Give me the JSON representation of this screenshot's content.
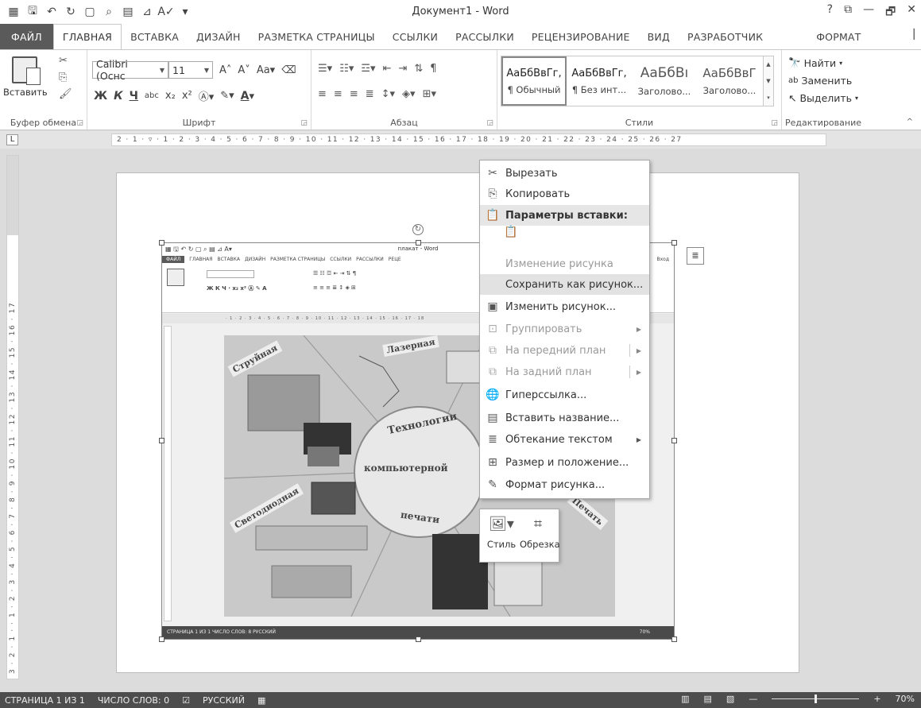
{
  "window": {
    "title": "Документ1 - Word",
    "controls": [
      "?",
      "⧉",
      "—",
      "🗗",
      "✕"
    ]
  },
  "tabs": [
    {
      "label": "ФАЙЛ"
    },
    {
      "label": "ГЛАВНАЯ"
    },
    {
      "label": "ВСТАВКА"
    },
    {
      "label": "ДИЗАЙН"
    },
    {
      "label": "РАЗМЕТКА СТРАНИЦЫ"
    },
    {
      "label": "ССЫЛКИ"
    },
    {
      "label": "РАССЫЛКИ"
    },
    {
      "label": "РЕЦЕНЗИРОВАНИЕ"
    },
    {
      "label": "ВИД"
    },
    {
      "label": "РАЗРАБОТЧИК"
    },
    {
      "label": "ФОРМАТ"
    }
  ],
  "ribbon": {
    "clipboard": {
      "paste_label": "Вставить",
      "group_label": "Буфер обмена"
    },
    "font": {
      "name": "Calibri (Оснс",
      "size": "11",
      "group_label": "Шрифт"
    },
    "paragraph": {
      "group_label": "Абзац"
    },
    "styles": {
      "group_label": "Стили",
      "items": [
        {
          "sample": "АаБбВвГг,",
          "name": "¶ Обычный"
        },
        {
          "sample": "АаБбВвГг,",
          "name": "¶ Без инт..."
        },
        {
          "sample": "АаБбВı",
          "name": "Заголово..."
        },
        {
          "sample": "АаБбВвГ",
          "name": "Заголово..."
        }
      ]
    },
    "editing": {
      "group_label": "Редактирование",
      "find": "Найти",
      "replace": "Заменить",
      "select": "Выделить"
    }
  },
  "ruler": {
    "h_numbers": "2 · 1 · ▿ · 1 · 2 · 3 · 4 · 5 · 6 · 7 · 8 · 9 · 10 · 11 · 12 · 13 · 14 · 15 · 16 · 17 · 18 · 19 · 20 · 21 · 22 · 23 · 24 · 25 · 26 · 27",
    "v_numbers": "3 · 2 · 1 · · 1 · 2 · 3 · 4 · 5 · 6 · 7 · 8 · 9 · 10 · 11 · 12 · 13 · 14 · 15 · 16 · 17"
  },
  "embedded": {
    "title": "плакат - Word",
    "tabs": [
      "ФАЙЛ",
      "ГЛАВНАЯ",
      "ВСТАВКА",
      "ДИЗАЙН",
      "РАЗМЕТКА СТРАНИЦЫ",
      "ССЫЛКИ",
      "РАССЫЛКИ",
      "РЕЦЕ"
    ],
    "enter": "Вход",
    "poster": {
      "center_top": "Технологии",
      "center_mid": "компьютерной",
      "center_bot": "печати",
      "sector_tl": "Струйная",
      "sector_tr": "Лазерная",
      "sector_bl": "Светодиодная",
      "sector_br": "Печать"
    },
    "status": "СТРАНИЦА 1 ИЗ 1   ЧИСЛО СЛОВ: 8   РУССКИЙ",
    "zoom": "70%"
  },
  "context_menu": {
    "items": [
      {
        "label": "Вырезать",
        "icon": "scissors-icon",
        "glyph": "✂",
        "state": "normal"
      },
      {
        "label": "Копировать",
        "icon": "copy-icon",
        "glyph": "⎘",
        "state": "normal"
      },
      {
        "label": "Параметры вставки:",
        "icon": "paste-icon",
        "glyph": "📋",
        "state": "header"
      },
      {
        "label": "Изменение рисунка",
        "icon": "",
        "glyph": "",
        "state": "disabled"
      },
      {
        "label": "Сохранить как рисунок...",
        "icon": "",
        "glyph": "",
        "state": "highlight"
      },
      {
        "label": "Изменить рисунок...",
        "icon": "change-picture-icon",
        "glyph": "▣",
        "state": "normal"
      },
      {
        "label": "Группировать",
        "icon": "group-icon",
        "glyph": "⊡",
        "state": "disabled",
        "submenu": true
      },
      {
        "label": "На передний план",
        "icon": "bring-forward-icon",
        "glyph": "⧉",
        "state": "disabled",
        "submenu": true
      },
      {
        "label": "На задний план",
        "icon": "send-backward-icon",
        "glyph": "⧉",
        "state": "disabled",
        "submenu": true
      },
      {
        "label": "Гиперссылка...",
        "icon": "hyperlink-icon",
        "glyph": "🌐",
        "state": "normal"
      },
      {
        "label": "Вставить название...",
        "icon": "caption-icon",
        "glyph": "▤",
        "state": "normal"
      },
      {
        "label": "Обтекание текстом",
        "icon": "wrap-text-icon",
        "glyph": "≣",
        "state": "normal",
        "submenu": true
      },
      {
        "label": "Размер и положение...",
        "icon": "size-position-icon",
        "glyph": "⊞",
        "state": "normal"
      },
      {
        "label": "Формат рисунка...",
        "icon": "format-picture-icon",
        "glyph": "✎",
        "state": "normal"
      }
    ]
  },
  "mini_toolbar": {
    "style": "Стиль",
    "crop": "Обрезка"
  },
  "status": {
    "page": "СТРАНИЦА 1 ИЗ 1",
    "words": "ЧИСЛО СЛОВ: 0",
    "lang": "РУССКИЙ",
    "zoom": "70%"
  }
}
